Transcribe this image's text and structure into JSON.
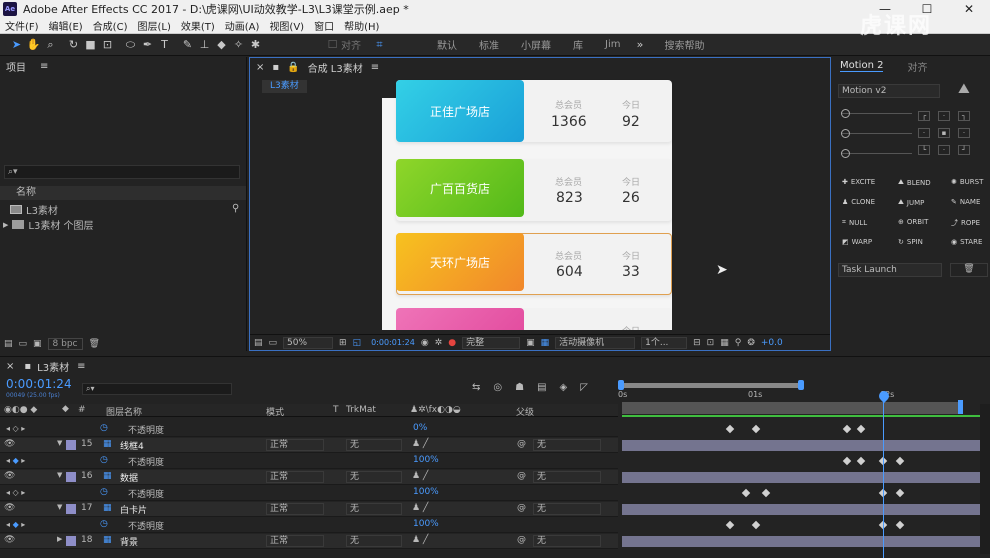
{
  "app": {
    "title": "Adobe After Effects CC 2017 - D:\\虎课网\\UI动效教学-L3\\L3课堂示例.aep *",
    "logo_text": "Ae",
    "watermark": "虎课网"
  },
  "menu": [
    "文件(F)",
    "编辑(E)",
    "合成(C)",
    "图层(L)",
    "效果(T)",
    "动画(A)",
    "视图(V)",
    "窗口",
    "帮助(H)"
  ],
  "toolbar": {
    "snap_label": "对齐",
    "workspaces": [
      "默认",
      "标准",
      "小屏幕",
      "库",
      "Jim"
    ],
    "search_placeholder": "搜索帮助"
  },
  "project": {
    "title": "项目",
    "column_name": "名称",
    "bpc": "8 bpc",
    "items": [
      {
        "name": "L3素材",
        "icon": "composition-icon"
      },
      {
        "name": "L3素材 个图层",
        "icon": "folder-icon"
      }
    ]
  },
  "composition": {
    "panel_title": "合成 L3素材",
    "tab": "L3素材",
    "zoom": "50%",
    "timecode": "0:00:01:24",
    "quality": "完整",
    "camera": "活动摄像机",
    "views": "1个...",
    "exposure": "+0.0",
    "cards": [
      {
        "store": "正佳广场店",
        "total_label": "总会员",
        "total": "1366",
        "today_label": "今日",
        "today": "92",
        "color_from": "#33d0e6",
        "color_to": "#1aa0d8"
      },
      {
        "store": "广百百货店",
        "total_label": "总会员",
        "total": "823",
        "today_label": "今日",
        "today": "26",
        "color_from": "#8fd62a",
        "color_to": "#52b91a"
      },
      {
        "store": "天环广场店",
        "total_label": "总会员",
        "total": "604",
        "today_label": "今日",
        "today": "33",
        "color_from": "#f7c21f",
        "color_to": "#f1872b"
      },
      {
        "store": "",
        "total_label": "",
        "total": "",
        "today_label": "今日",
        "today": "",
        "color_from": "#ef74b8",
        "color_to": "#e0449a"
      }
    ]
  },
  "right_panel": {
    "tabs": [
      "Motion 2",
      "对齐"
    ],
    "preset": "Motion v2",
    "effects": [
      "EXCITE",
      "BLEND",
      "BURST",
      "CLONE",
      "JUMP",
      "NAME",
      "NULL",
      "ORBIT",
      "ROPE",
      "WARP",
      "SPIN",
      "STARE"
    ],
    "task": "Task Launch"
  },
  "timeline": {
    "comp_tab": "L3素材",
    "timecode": "0:00:01:24",
    "frame_info": "00049 (25.00 fps)",
    "columns": {
      "name": "图层名称",
      "mode": "模式",
      "t": "T",
      "trkmat": "TrkMat",
      "parent": "父级"
    },
    "ruler": [
      "0s",
      "01s",
      "02s"
    ],
    "rows": [
      {
        "type": "prop",
        "label": "不透明度",
        "value": "0%"
      },
      {
        "type": "layer",
        "num": "15",
        "name": "线框4",
        "mode": "正常",
        "trk": "无",
        "parent": "无"
      },
      {
        "type": "prop",
        "label": "不透明度",
        "value": "100%"
      },
      {
        "type": "layer",
        "num": "16",
        "name": "数据",
        "mode": "正常",
        "trk": "无",
        "parent": "无"
      },
      {
        "type": "prop",
        "label": "不透明度",
        "value": "100%"
      },
      {
        "type": "layer",
        "num": "17",
        "name": "白卡片",
        "mode": "正常",
        "trk": "无",
        "parent": "无"
      },
      {
        "type": "prop",
        "label": "不透明度",
        "value": "100%"
      },
      {
        "type": "layer",
        "num": "18",
        "name": "背景",
        "mode": "正常",
        "trk": "无",
        "parent": "无"
      }
    ]
  },
  "colors": {
    "accent": "#4a9bff",
    "selection": "#3a70c2",
    "keyframe": "#d0d0d0"
  }
}
